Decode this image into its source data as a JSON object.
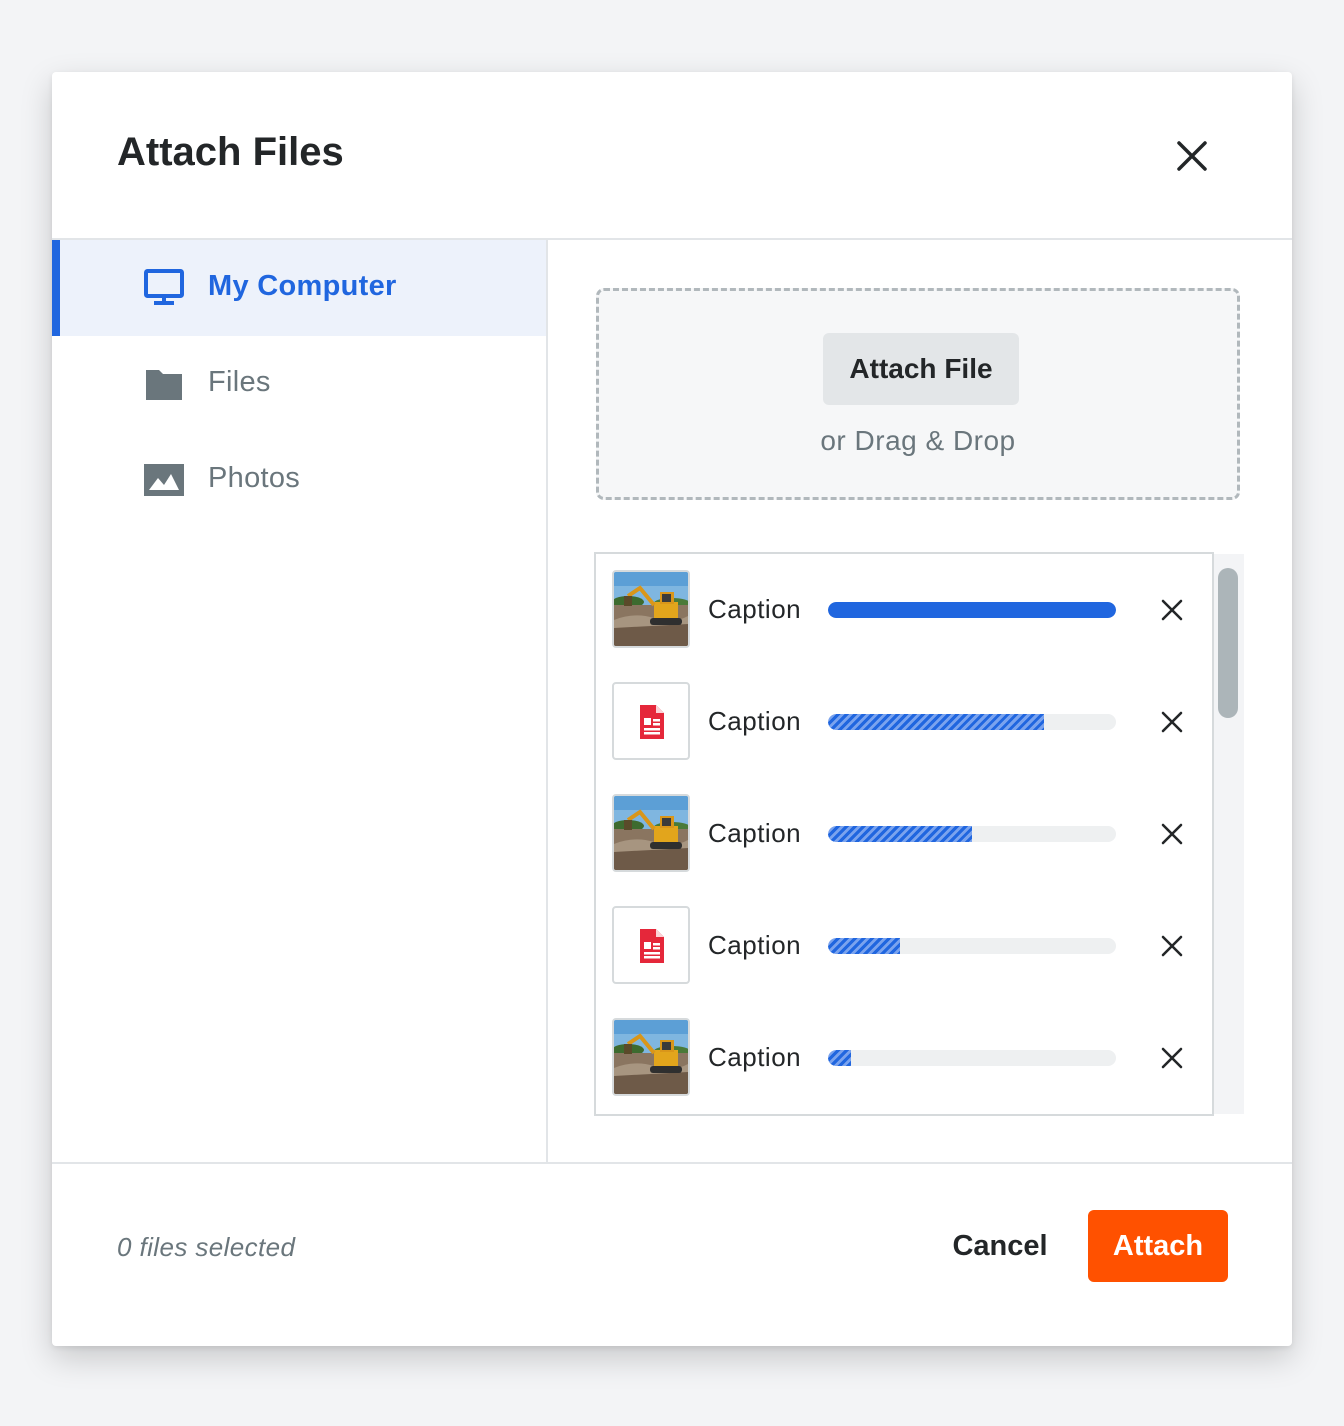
{
  "dialog": {
    "title": "Attach Files"
  },
  "sidebar": {
    "items": [
      {
        "label": "My Computer",
        "icon": "monitor-icon",
        "active": true
      },
      {
        "label": "Files",
        "icon": "folder-icon",
        "active": false
      },
      {
        "label": "Photos",
        "icon": "image-icon",
        "active": false
      }
    ]
  },
  "dropzone": {
    "button_label": "Attach File",
    "hint": "or Drag & Drop"
  },
  "uploads": [
    {
      "caption": "Caption",
      "thumbnail": "photo-thumbnail",
      "progress": 1.0
    },
    {
      "caption": "Caption",
      "thumbnail": "pdf-file-icon",
      "progress": 0.75
    },
    {
      "caption": "Caption",
      "thumbnail": "photo-thumbnail",
      "progress": 0.5
    },
    {
      "caption": "Caption",
      "thumbnail": "pdf-file-icon",
      "progress": 0.25
    },
    {
      "caption": "Caption",
      "thumbnail": "photo-thumbnail",
      "progress": 0.08
    }
  ],
  "footer": {
    "selected_text": "0 files selected",
    "cancel_label": "Cancel",
    "attach_label": "Attach"
  },
  "colors": {
    "accent": "#2066df",
    "primary_button": "#ff5100",
    "pdf_icon": "#e5273a"
  }
}
